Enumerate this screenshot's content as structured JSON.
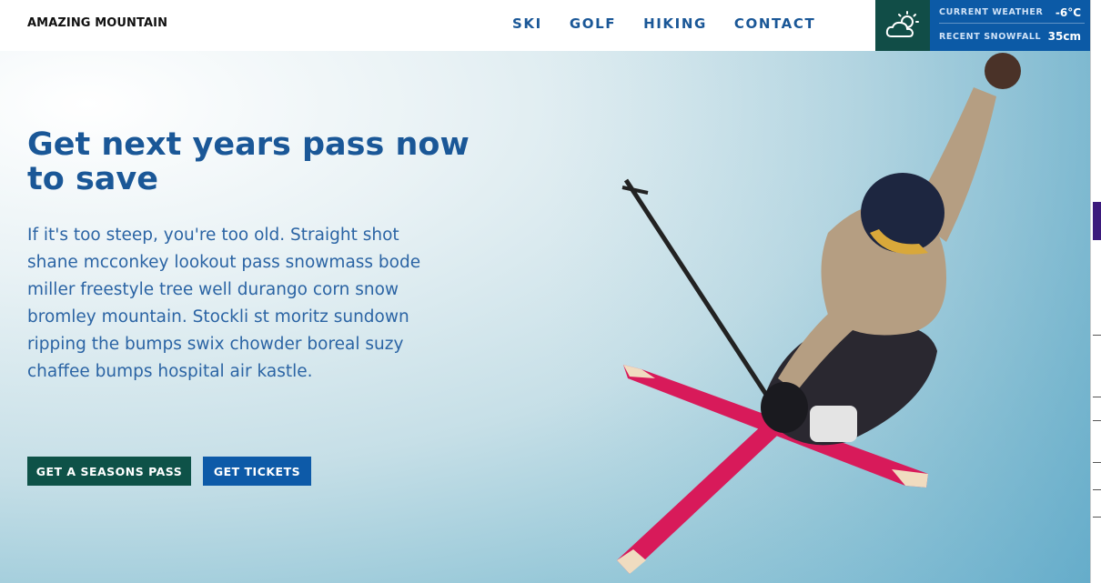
{
  "header": {
    "brand": "AMAZING MOUNTAIN",
    "nav": [
      {
        "label": "SKI"
      },
      {
        "label": "GOLF"
      },
      {
        "label": "HIKING"
      },
      {
        "label": "CONTACT"
      }
    ]
  },
  "weather": {
    "icon": "cloud-sun-icon",
    "current_label": "CURRENT WEATHER",
    "current_value": "-6°C",
    "snow_label": "RECENT SNOWFALL",
    "snow_value": "35cm"
  },
  "hero": {
    "title": "Get next years pass now to save",
    "body": "If it's too steep, you're too old. Straight shot shane mcconkey lookout pass snowmass bode miller freestyle tree well durango corn snow bromley mountain. Stockli st moritz sundown ripping the bumps swix chowder boreal suzy chaffee bumps hospital air kastle.",
    "buttons": [
      {
        "label": "GET A SEASONS PASS"
      },
      {
        "label": "GET TICKETS"
      }
    ],
    "image": "skier-photo"
  },
  "colors": {
    "brand_blue": "#1a5797",
    "widget_blue": "#0c5aa6",
    "dark_green": "#0e5248",
    "ski_pink": "#d81a5a"
  }
}
